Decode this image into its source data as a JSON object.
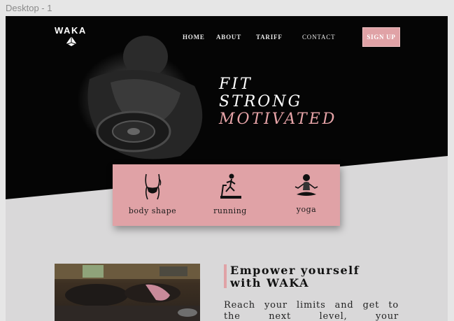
{
  "frame_label": "Desktop - 1",
  "brand": {
    "name": "WAKA",
    "mark": "logo-mark-icon"
  },
  "nav": {
    "home": "HOME",
    "about": "ABOUT",
    "tariff": "TARIFF",
    "contact": "CONTACT",
    "signup": "SIGN UP"
  },
  "hero": {
    "line1": "FIT",
    "line2": "STRONG",
    "line3": "MOTIVATED"
  },
  "features": [
    {
      "label": "body shape",
      "icon": "body-shape-icon"
    },
    {
      "label": "running",
      "icon": "treadmill-runner-icon"
    },
    {
      "label": "yoga",
      "icon": "yoga-pose-icon"
    }
  ],
  "section": {
    "title_line1": "Empower yourself",
    "title_line2": "with WAKA",
    "body_line1": "Reach your limits and get to",
    "body_line2": "the next level, your"
  },
  "colors": {
    "accent": "#e0a2a6",
    "hero_bg": "#050505",
    "page_bg": "#d9d8d9"
  }
}
